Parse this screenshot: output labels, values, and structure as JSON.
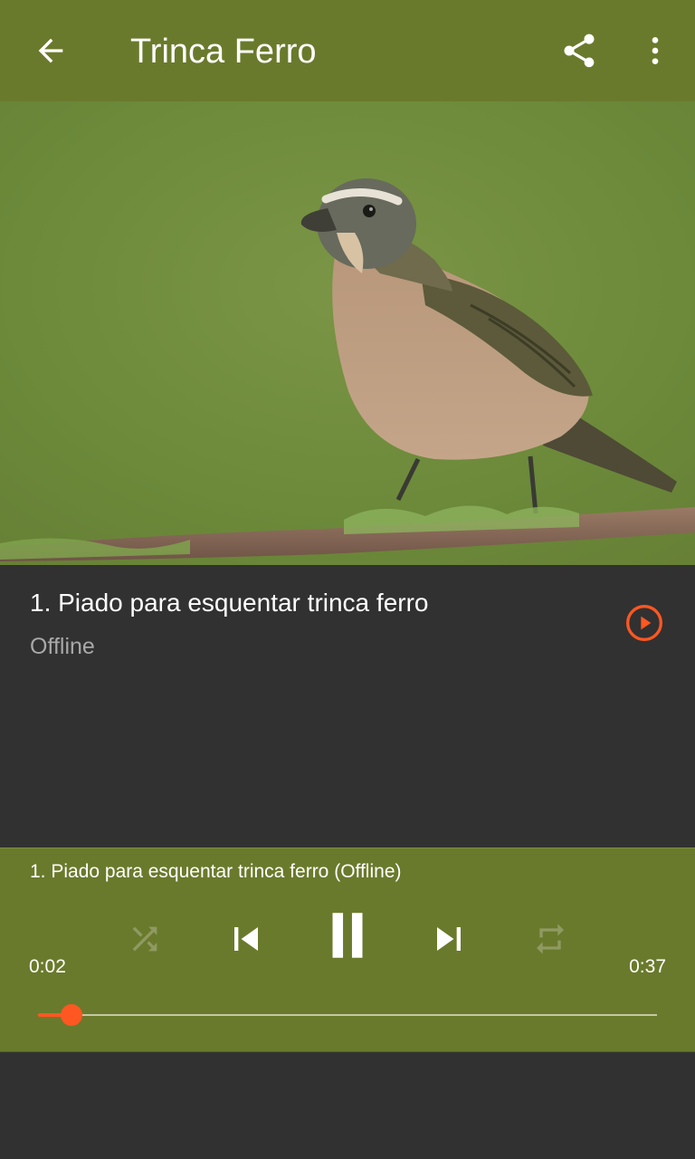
{
  "appbar": {
    "title": "Trinca Ferro",
    "back_icon": "arrow-back-icon",
    "share_icon": "share-icon",
    "more_icon": "more-vert-icon"
  },
  "hero": {
    "subject": "bird-photo"
  },
  "track": {
    "title": "1. Piado para esquentar trinca ferro",
    "status": "Offline",
    "play_icon": "play-circle-icon"
  },
  "player": {
    "now_playing": "1. Piado para esquentar trinca ferro (Offline)",
    "current_time": "0:02",
    "total_time": "0:37",
    "progress_fraction": 0.054,
    "controls": [
      "shuffle-icon",
      "skip-previous-icon",
      "pause-icon",
      "skip-next-icon",
      "repeat-icon"
    ]
  },
  "colors": {
    "toolbar": "#6a7a2c",
    "background": "#313131",
    "accent": "#ff5722",
    "secondary_text": "#a8a8a8"
  }
}
